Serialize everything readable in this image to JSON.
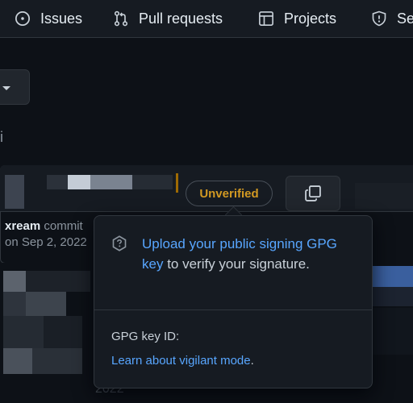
{
  "nav": {
    "issues_label": "Issues",
    "pulls_label": "Pull requests",
    "projects_label": "Projects",
    "security_label": "Se"
  },
  "left": {
    "glyph": "i"
  },
  "commit": {
    "author": "xream",
    "action_text": "commit",
    "date_text": "on Sep 2, 2022",
    "badge_label": "Unverified",
    "faint_text": "2022"
  },
  "popover": {
    "link_text": "Upload your public signing GPG key",
    "rest_text": " to verify your signature.",
    "gpg_label": "GPG key ID:",
    "learn_link": "Learn about vigilant mode",
    "learn_tail": "."
  },
  "colors": {
    "accent_link": "#58a6ff",
    "unverified": "#d29922",
    "background": "#0d1117",
    "panel": "#161b22",
    "border": "#30363d"
  },
  "icons": [
    "issue-opened-icon",
    "git-pull-request-icon",
    "table-icon",
    "shield-icon",
    "copy-icon",
    "question-icon",
    "chevron-down-icon"
  ]
}
